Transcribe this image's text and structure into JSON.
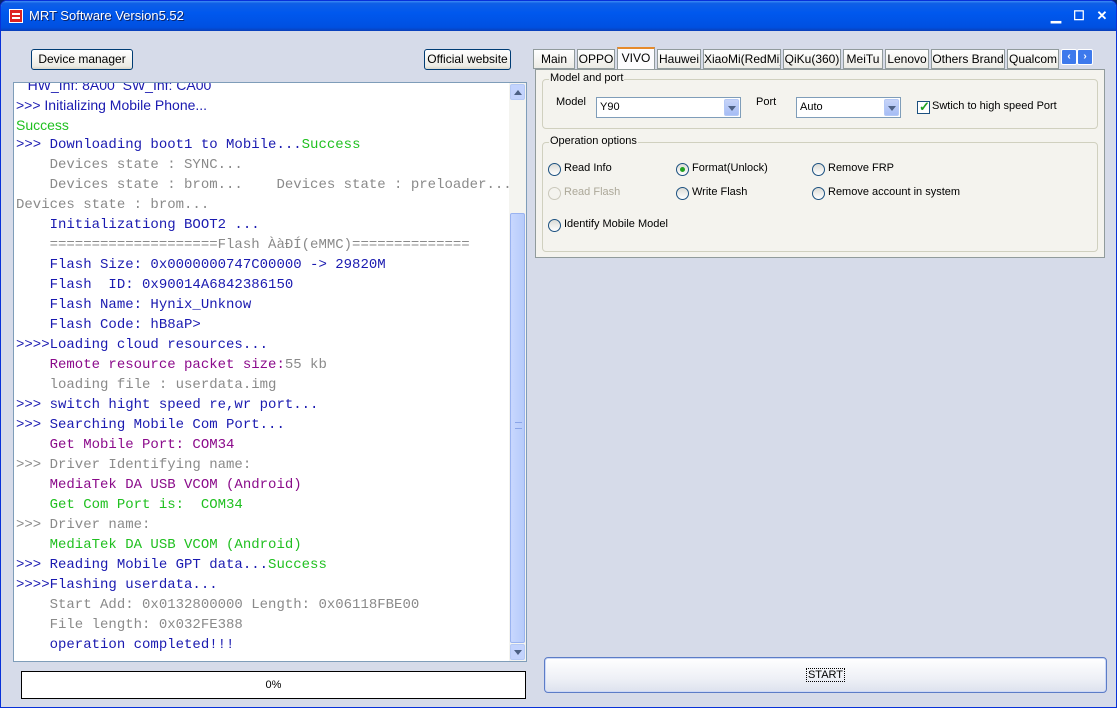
{
  "window": {
    "title": "MRT Software Version5.52"
  },
  "toolbar": {
    "device_manager": "Device manager",
    "official_website": "Official website"
  },
  "log": [
    {
      "text": "   HW_Inf: 8A00  SW_Inf: CA00",
      "color": "c-blue",
      "font": "sans"
    },
    {
      "text": ">>> Initializing Mobile Phone...",
      "color": "c-blue",
      "font": "sans"
    },
    {
      "text": "Success",
      "color": "c-green",
      "font": "sans"
    },
    {
      "parts": [
        {
          "t": ">>> Downloading boot1 to Mobile...",
          "c": "c-blue"
        },
        {
          "t": "Success",
          "c": "c-green"
        }
      ]
    },
    {
      "text": "    Devices state : SYNC...",
      "color": "c-gray"
    },
    {
      "text": "    Devices state : brom...    Devices state : preloader...",
      "color": "c-gray"
    },
    {
      "text": "Devices state : brom...",
      "color": "c-gray"
    },
    {
      "text": "    Initializationg BOOT2 ...",
      "color": "c-blue"
    },
    {
      "text": "    ====================Flash ÀàÐÍ(eMMC)==============",
      "color": "c-gray"
    },
    {
      "text": "    Flash Size: 0x0000000747C00000 -> 29820M",
      "color": "c-blue"
    },
    {
      "text": "    Flash  ID: 0x90014A6842386150",
      "color": "c-blue"
    },
    {
      "text": "    Flash Name: Hynix_Unknow",
      "color": "c-blue"
    },
    {
      "text": "    Flash Code: hB8aP>",
      "color": "c-blue"
    },
    {
      "text": ">>>>Loading cloud resources...",
      "color": "c-blue"
    },
    {
      "parts": [
        {
          "t": "    Remote resource packet size:",
          "c": "c-purple"
        },
        {
          "t": "55 kb",
          "c": "c-gray"
        }
      ]
    },
    {
      "text": "    loading file : userdata.img",
      "color": "c-gray"
    },
    {
      "text": ">>> switch hight speed re,wr port...",
      "color": "c-blue"
    },
    {
      "text": ">>> Searching Mobile Com Port...",
      "color": "c-blue"
    },
    {
      "text": "    Get Mobile Port: COM34",
      "color": "c-purple"
    },
    {
      "text": ">>> Driver Identifying name:",
      "color": "c-gray"
    },
    {
      "text": "    MediaTek DA USB VCOM (Android)",
      "color": "c-purple"
    },
    {
      "text": "    Get Com Port is:  COM34",
      "color": "c-green"
    },
    {
      "text": ">>> Driver name:",
      "color": "c-gray"
    },
    {
      "text": "    MediaTek DA USB VCOM (Android)",
      "color": "c-green"
    },
    {
      "parts": [
        {
          "t": ">>> Reading Mobile GPT data...",
          "c": "c-blue"
        },
        {
          "t": "Success",
          "c": "c-green"
        }
      ]
    },
    {
      "text": ">>>>Flashing userdata...",
      "color": "c-blue"
    },
    {
      "text": "    Start Add: 0x0132800000 Length: 0x06118FBE00",
      "color": "c-gray"
    },
    {
      "text": "    File length: 0x032FE388",
      "color": "c-gray"
    },
    {
      "text": "    operation completed!!!",
      "color": "c-blue"
    }
  ],
  "progress": {
    "label": "0%",
    "value": 0
  },
  "tabs": [
    "Main",
    "OPPO",
    "VIVO",
    "Hauwei",
    "XiaoMi(RedMi)",
    "QiKu(360)",
    "MeiTu",
    "Lenovo",
    "Others Brand",
    "Qualcom"
  ],
  "active_tab": "VIVO",
  "model_port": {
    "legend": "Model and port",
    "model_label": "Model",
    "model_value": "Y90",
    "port_label": "Port",
    "port_value": "Auto",
    "high_speed_label": "Swtich to high speed Port",
    "high_speed_checked": true
  },
  "operation_options": {
    "legend": "Operation options",
    "read_info": "Read Info",
    "format_unlock": "Format(Unlock)",
    "remove_frp": "Remove FRP",
    "read_flash": "Read Flash",
    "write_flash": "Write Flash",
    "remove_account": "Remove account in system",
    "identify_model": "Identify Mobile Model",
    "selected": "Format(Unlock)"
  },
  "start_button": "START"
}
